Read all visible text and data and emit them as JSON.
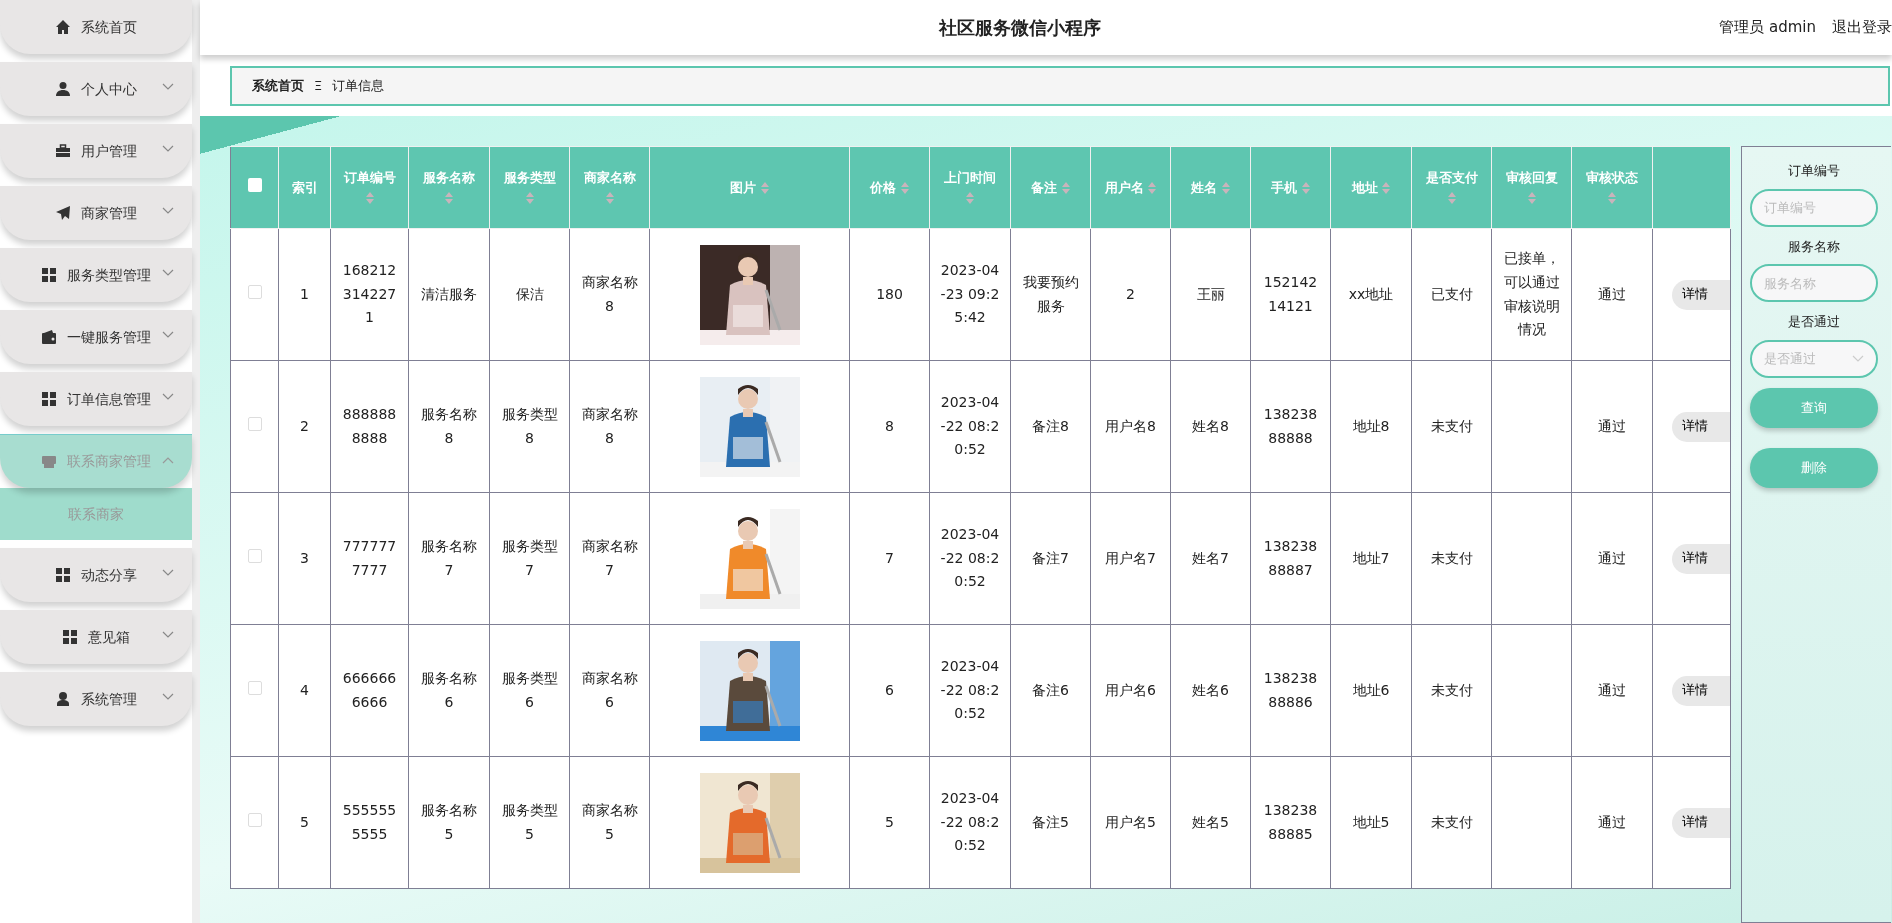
{
  "sidebar": {
    "items": [
      {
        "label": "系统首页",
        "kind": "link",
        "expanded": false
      },
      {
        "label": "个人中心",
        "kind": "menu",
        "expanded": false
      },
      {
        "label": "用户管理",
        "kind": "menu",
        "expanded": false
      },
      {
        "label": "商家管理",
        "kind": "menu",
        "expanded": false
      },
      {
        "label": "服务类型管理",
        "kind": "menu",
        "expanded": false
      },
      {
        "label": "一键服务管理",
        "kind": "menu",
        "expanded": false
      },
      {
        "label": "订单信息管理",
        "kind": "menu",
        "expanded": false
      },
      {
        "label": "联系商家管理",
        "kind": "menu",
        "expanded": true,
        "children": [
          {
            "label": "联系商家"
          }
        ]
      },
      {
        "label": "动态分享",
        "kind": "menu",
        "expanded": false
      },
      {
        "label": "意见箱",
        "kind": "menu",
        "expanded": false
      },
      {
        "label": "系统管理",
        "kind": "menu",
        "expanded": false
      }
    ]
  },
  "header": {
    "title": "社区服务微信小程序",
    "user": "管理员 admin",
    "logout": "退出登录"
  },
  "breadcrumb": {
    "items": [
      "系统首页",
      "订单信息"
    ],
    "separator": "Ξ"
  },
  "table": {
    "select_all_checked": false,
    "columns": [
      {
        "label": "索引",
        "sortable": false
      },
      {
        "label": "订单编号",
        "sortable": true
      },
      {
        "label": "服务名称",
        "sortable": true
      },
      {
        "label": "服务类型",
        "sortable": true
      },
      {
        "label": "商家名称",
        "sortable": true
      },
      {
        "label": "图片",
        "sortable": true
      },
      {
        "label": "价格",
        "sortable": true
      },
      {
        "label": "上门时间",
        "sortable": true
      },
      {
        "label": "备注",
        "sortable": true
      },
      {
        "label": "用户名",
        "sortable": true
      },
      {
        "label": "姓名",
        "sortable": true
      },
      {
        "label": "手机",
        "sortable": true
      },
      {
        "label": "地址",
        "sortable": true
      },
      {
        "label": "是否支付",
        "sortable": true
      },
      {
        "label": "审核回复",
        "sortable": true
      },
      {
        "label": "审核状态",
        "sortable": true
      }
    ],
    "rows": [
      {
        "checked": false,
        "index": "1",
        "order_no": "1682123142271",
        "service_name": "清洁服务",
        "service_type": "保洁",
        "merchant": "商家名称8",
        "price": "180",
        "visit_time": "2023-04-23 09:25:42",
        "note": "我要预约服务",
        "username": "2",
        "name": "王丽",
        "phone": "15214214121",
        "address": "xx地址",
        "paid": "已支付",
        "reply": "已接单，可以通过审核说明情况",
        "status": "通过",
        "action": "详情"
      },
      {
        "checked": false,
        "index": "2",
        "order_no": "8888888888",
        "service_name": "服务名称8",
        "service_type": "服务类型8",
        "merchant": "商家名称8",
        "price": "8",
        "visit_time": "2023-04-22 08:20:52",
        "note": "备注8",
        "username": "用户名8",
        "name": "姓名8",
        "phone": "13823888888",
        "address": "地址8",
        "paid": "未支付",
        "status": "通过",
        "action": "详情"
      },
      {
        "checked": false,
        "index": "3",
        "order_no": "7777777777",
        "service_name": "服务名称7",
        "service_type": "服务类型7",
        "merchant": "商家名称7",
        "price": "7",
        "visit_time": "2023-04-22 08:20:52",
        "note": "备注7",
        "username": "用户名7",
        "name": "姓名7",
        "phone": "13823888887",
        "address": "地址7",
        "paid": "未支付",
        "status": "通过",
        "action": "详情"
      },
      {
        "checked": false,
        "index": "4",
        "order_no": "6666666666",
        "service_name": "服务名称6",
        "service_type": "服务类型6",
        "merchant": "商家名称6",
        "price": "6",
        "visit_time": "2023-04-22 08:20:52",
        "note": "备注6",
        "username": "用户名6",
        "name": "姓名6",
        "phone": "13823888886",
        "address": "地址6",
        "paid": "未支付",
        "status": "通过",
        "action": "详情"
      },
      {
        "checked": false,
        "index": "5",
        "order_no": "5555555555",
        "service_name": "服务名称5",
        "service_type": "服务类型5",
        "merchant": "商家名称5",
        "price": "5",
        "visit_time": "2023-04-22 08:20:52",
        "note": "备注5",
        "username": "用户名5",
        "name": "姓名5",
        "phone": "13823888885",
        "address": "地址5",
        "paid": "未支付",
        "status": "通过",
        "action": "详情"
      }
    ]
  },
  "search_panel": {
    "fields": [
      {
        "kind": "input",
        "label": "订单编号",
        "placeholder": "订单编号"
      },
      {
        "kind": "input",
        "label": "服务名称",
        "placeholder": "服务名称"
      },
      {
        "kind": "select",
        "label": "是否通过",
        "placeholder": "是否通过"
      }
    ],
    "buttons": [
      "查询",
      "删除"
    ]
  }
}
